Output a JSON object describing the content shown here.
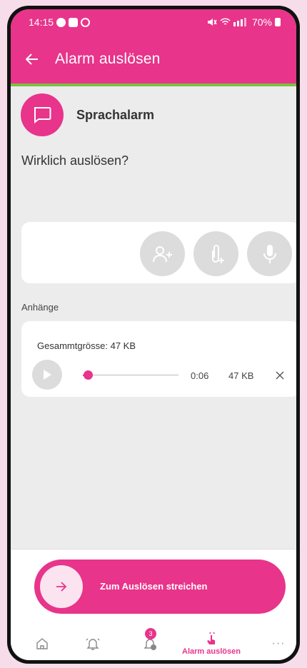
{
  "status": {
    "time": "14:15",
    "battery": "70%"
  },
  "toolbar": {
    "title": "Alarm auslösen",
    "back_icon": "arrow-left-icon"
  },
  "alarm": {
    "type_label": "Sprachalarm",
    "question": "Wirklich auslösen?"
  },
  "attachments": {
    "section_label": "Anhänge",
    "total_size": "Gesammtgrösse: 47 KB",
    "audio": {
      "duration": "0:06",
      "size": "47 KB",
      "progress": 0.05
    }
  },
  "swipe": {
    "label": "Zum Auslösen streichen"
  },
  "nav": {
    "badge_count": "3",
    "active_label": "Alarm auslösen"
  },
  "colors": {
    "accent": "#e8348b",
    "accent_line": "#7ac142",
    "background": "#ececec"
  }
}
